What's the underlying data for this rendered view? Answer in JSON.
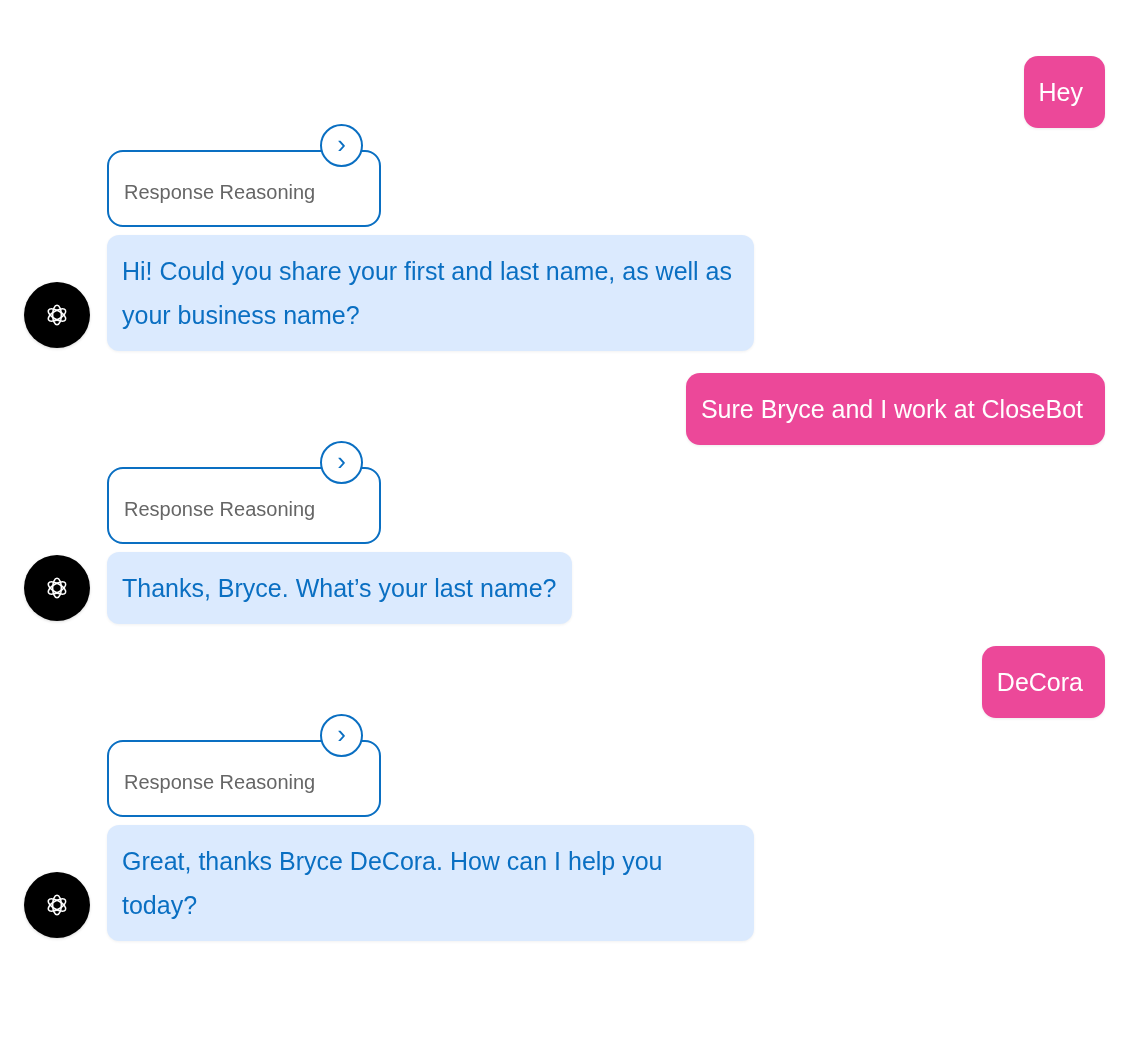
{
  "messages": [
    {
      "kind": "user",
      "text": "Hey"
    },
    {
      "kind": "bot",
      "reasoning": "Response Reasoning",
      "expand_icon": "›",
      "text": "Hi! Could you share your first and last name, as well as your business name?"
    },
    {
      "kind": "user",
      "text": "Sure Bryce and I work at CloseBot"
    },
    {
      "kind": "bot",
      "reasoning": "Response Reasoning",
      "expand_icon": "›",
      "text": "Thanks, Bryce. What’s your last name?"
    },
    {
      "kind": "user",
      "text": "DeCora"
    },
    {
      "kind": "bot",
      "reasoning": "Response Reasoning",
      "expand_icon": "›",
      "text": "Great, thanks Bryce DeCora. How can I help you today?"
    }
  ]
}
